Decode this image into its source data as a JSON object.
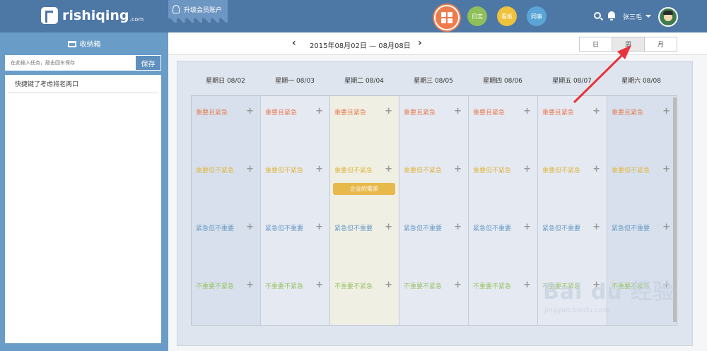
{
  "header": {
    "logo_text": "rishiqing",
    "logo_sub": ".com",
    "upgrade_label": "升级会员账户",
    "nav": [
      {
        "label": "日志",
        "color": "#8fbf58"
      },
      {
        "label": "看板",
        "color": "#efc23c"
      },
      {
        "label": "同事",
        "color": "#5ba5d6"
      }
    ],
    "home_color": "#ef7c4c",
    "username": "张三毛"
  },
  "sidebar": {
    "title": "收纳箱",
    "input_placeholder": "在此输入任务，敲击回车保存",
    "save_label": "保存",
    "items": [
      "快捷键了考虑将老两口"
    ]
  },
  "calendar": {
    "range": "2015年08月02日 — 08月08日",
    "views": [
      "日",
      "周",
      "月"
    ],
    "active_view": "周",
    "days": [
      "星期日 08/02",
      "星期一 08/03",
      "星期二 08/04",
      "星期三 08/05",
      "星期四 08/06",
      "星期五 08/07",
      "星期六 08/08"
    ],
    "quadrants": [
      "重要且紧急",
      "重要但不紧急",
      "紧急但不重要",
      "不重要不紧急"
    ],
    "task": "企业的需求"
  },
  "watermark": {
    "brand": "Bai du 经验",
    "url": "jingyan.baidu.com"
  }
}
